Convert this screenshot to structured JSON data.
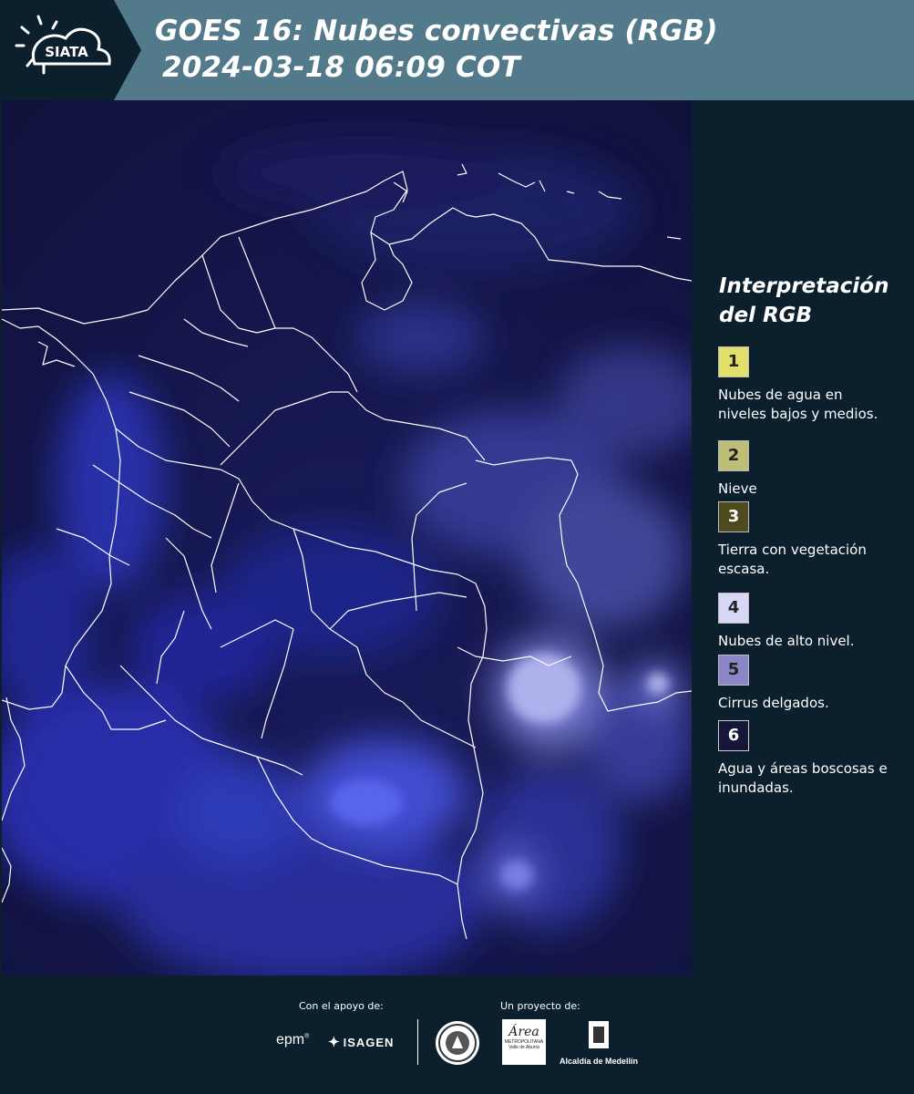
{
  "header": {
    "title_line1": "GOES 16: Nubes convectivas (RGB)",
    "title_line2": "2024-03-18 06:09 COT",
    "logo_text": "SIATA",
    "background": "#527a8a"
  },
  "legend": {
    "title_line1": "Interpretación",
    "title_line2": "del RGB",
    "items": [
      {
        "num": "1",
        "color": "#e0e06a",
        "text": "Nubes de agua en niveles bajos y medios."
      },
      {
        "num": "2",
        "color": "#bdbe78",
        "text": "Nieve"
      },
      {
        "num": "3",
        "color": "#4d4a1e",
        "text": "Tierra con vegetación escasa."
      },
      {
        "num": "4",
        "color": "#d8d7f5",
        "text": "Nubes de alto nivel."
      },
      {
        "num": "5",
        "color": "#8a86c8",
        "text": "Cirrus delgados."
      },
      {
        "num": "6",
        "color": "#15163a",
        "text": "Agua y áreas boscosas e inundadas."
      }
    ]
  },
  "footer": {
    "support_label": "Con el apoyo de:",
    "project_label": "Un proyecto de:",
    "epm": "epm",
    "isagen": "ISAGEN",
    "area_metro": "Área",
    "area_sub": "METROPOLITANA",
    "area_sub2": "Valle de Aburrá",
    "alcaldia": "Alcaldía de Medellín"
  },
  "map": {
    "type": "satellite RGB composite",
    "cloud_color": "#3b4dd8",
    "background_color": "#121341",
    "border_color": "#ffffff"
  }
}
